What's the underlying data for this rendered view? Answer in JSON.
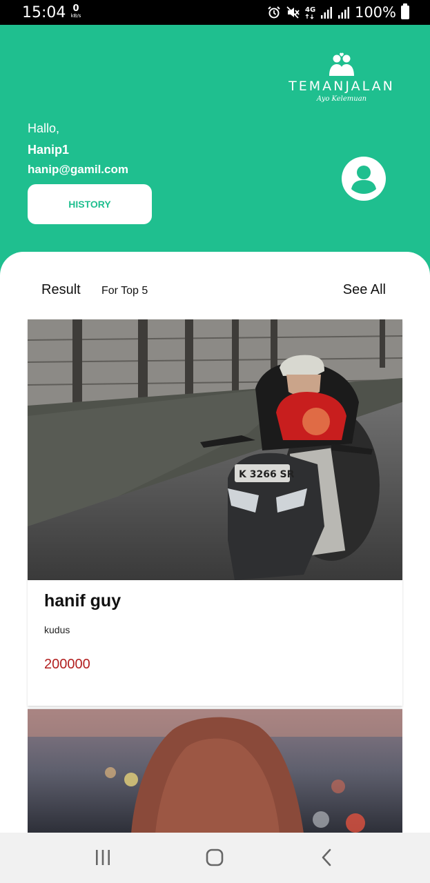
{
  "status_bar": {
    "time": "15:04",
    "net_speed": "0",
    "net_unit": "kB/s",
    "network": "4G",
    "battery": "100%",
    "icons": [
      "alarm-icon",
      "mute-icon",
      "4g-icon",
      "signal-icon",
      "signal-icon",
      "battery-icon"
    ]
  },
  "header": {
    "logo_title": "TEMANJALAN",
    "logo_tagline": "Ayo Kelemuan",
    "greeting": "Hallo,",
    "username": "Hanip1",
    "email": "hanip@gamil.com",
    "history_label": "HISTORY",
    "avatar_icon": "user-icon"
  },
  "results": {
    "title": "Result",
    "subtitle": "For Top 5",
    "see_all_label": "See All",
    "items": [
      {
        "name": "hanif guy",
        "location": "kudus",
        "price": "200000"
      }
    ]
  },
  "nav": {
    "icons": [
      "recent-apps-icon",
      "home-icon",
      "back-icon"
    ]
  },
  "colors": {
    "primary": "#1fbf8f",
    "price": "#b21f1f",
    "surface": "#ffffff"
  }
}
